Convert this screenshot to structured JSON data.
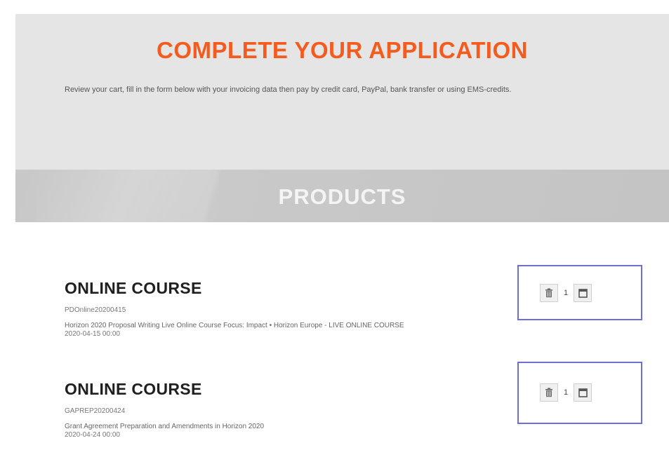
{
  "header": {
    "title": "COMPLETE YOUR APPLICATION",
    "intro": "Review your cart, fill in the form below with your invoicing data then pay by credit card, PayPal, bank transfer or using EMS-credits."
  },
  "section": {
    "title": "PRODUCTS"
  },
  "products": [
    {
      "type": "ONLINE COURSE",
      "code": "PDOnline20200415",
      "description": "Horizon 2020 Proposal Writing Live Online Course Focus: Impact • Horizon Europe - LIVE ONLINE COURSE",
      "date": "2020-04-15 00:00",
      "quantity": "1",
      "delete_icon": "trash-icon",
      "edit_icon": "square-icon"
    },
    {
      "type": "ONLINE COURSE",
      "code": "GAPREP20200424",
      "description": "Grant Agreement Preparation and Amendments in Horizon 2020",
      "date": "2020-04-24 00:00",
      "quantity": "1",
      "delete_icon": "trash-icon",
      "edit_icon": "square-icon"
    }
  ],
  "colors": {
    "accent": "#f45b1f",
    "highlight_border": "#6b6fd6",
    "hero_bg": "#e5e5e5",
    "band_bg": "#c8c8c8"
  }
}
